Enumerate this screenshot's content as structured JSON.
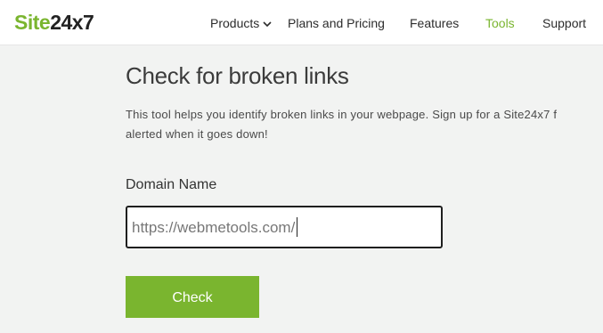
{
  "header": {
    "logo_site": "Site",
    "logo_num": "24x7",
    "nav": {
      "products": "Products",
      "plans": "Plans and Pricing",
      "features": "Features",
      "tools": "Tools",
      "support": "Support"
    }
  },
  "main": {
    "title": "Check for broken links",
    "description_line1": "This tool helps you identify broken links in your webpage. Sign up for a Site24x7 f",
    "description_line2": "alerted when it goes down!",
    "field_label": "Domain Name",
    "input_value": "https://webmetools.com/",
    "button_label": "Check"
  },
  "colors": {
    "brand_green": "#7ab52f",
    "background": "#f2f3f2"
  },
  "icons": {
    "products_dropdown": "chevron-down-icon"
  }
}
